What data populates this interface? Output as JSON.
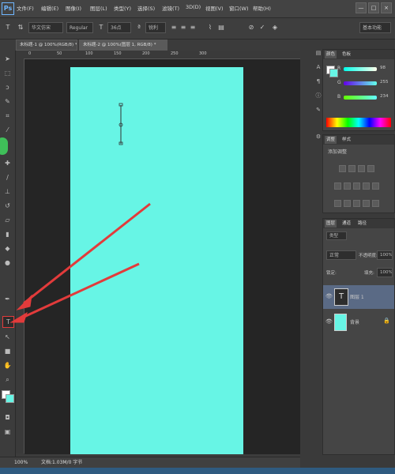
{
  "menubar": {
    "logo": "Ps",
    "items": [
      "文件(F)",
      "编辑(E)",
      "图像(I)",
      "图层(L)",
      "类型(Y)",
      "选择(S)",
      "滤镜(T)",
      "3D(D)",
      "视图(V)",
      "窗口(W)",
      "帮助(H)"
    ],
    "window_buttons": [
      "—",
      "□",
      "×"
    ]
  },
  "options": {
    "tool_icon": "T",
    "font_family": "华文仿宋",
    "font_style": "Regular",
    "font_size": "36点",
    "antialias": "锐利",
    "workspace": "基本功能"
  },
  "tabs": [
    {
      "label": "未标题-1 @ 100%(RGB/8) *"
    },
    {
      "label": "未标题-2 @ 100%(图层 1, RGB/8) *"
    }
  ],
  "ruler": {
    "top_ticks": [
      "0",
      "50",
      "100",
      "150",
      "200",
      "250",
      "300"
    ]
  },
  "status": {
    "zoom": "100%",
    "doc_info": "文档:1.03M/0 字节"
  },
  "panels": {
    "color": {
      "tabs": [
        "颜色",
        "色板"
      ],
      "sliders": [
        {
          "label": "R",
          "value": "98"
        },
        {
          "label": "G",
          "value": "255"
        },
        {
          "label": "B",
          "value": "234"
        }
      ]
    },
    "adjustments": {
      "tabs": [
        "调整",
        "样式"
      ],
      "title": "添加调整"
    },
    "layers": {
      "tabs": [
        "图层",
        "通道",
        "路径"
      ],
      "filter_label": "类型",
      "blend_mode": "正常",
      "opacity_label": "不透明度:",
      "opacity_value": "100%",
      "fill_label": "填充:",
      "fill_value": "100%",
      "lock_label": "锁定:",
      "items": [
        {
          "name": "图层 1",
          "kind": "text-layer",
          "selected": true
        },
        {
          "name": "背景",
          "kind": "background",
          "selected": false
        }
      ]
    }
  },
  "colors": {
    "canvas_fill": "#67f5e5",
    "annotation_arrow": "#e23b3b"
  }
}
